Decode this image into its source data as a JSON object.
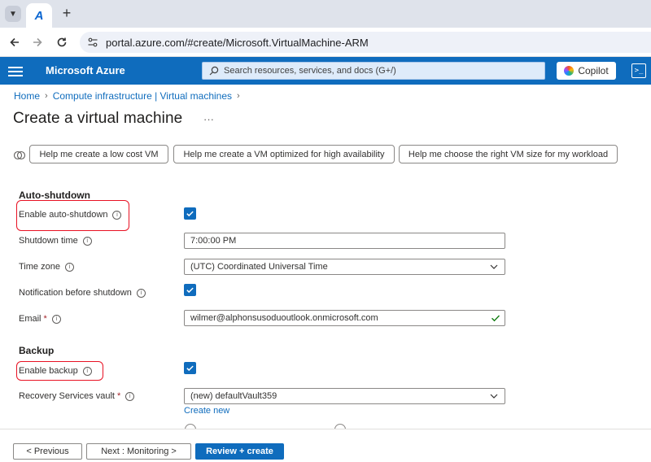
{
  "browser": {
    "new_tab_symbol": "+",
    "url": "portal.azure.com/#create/Microsoft.VirtualMachine-ARM"
  },
  "header": {
    "brand": "Microsoft Azure",
    "search_placeholder": "Search resources, services, and docs (G+/)",
    "copilot_label": "Copilot"
  },
  "breadcrumb": [
    "Home",
    "Compute infrastructure | Virtual machines"
  ],
  "page": {
    "title": "Create a virtual machine",
    "more": "···"
  },
  "suggestions": [
    "Help me create a low cost VM",
    "Help me create a VM optimized for high availability",
    "Help me choose the right VM size for my workload"
  ],
  "auto_shutdown": {
    "section_title": "Auto-shutdown",
    "enable_label": "Enable auto-shutdown",
    "enable_checked": true,
    "shutdown_time_label": "Shutdown time",
    "shutdown_time_value": "7:00:00 PM",
    "time_zone_label": "Time zone",
    "time_zone_value": "(UTC) Coordinated Universal Time",
    "notification_label": "Notification before shutdown",
    "notification_checked": true,
    "email_label": "Email",
    "email_required": "*",
    "email_value": "wilmer@alphonsusoduoutlook.onmicrosoft.com"
  },
  "backup": {
    "section_title": "Backup",
    "enable_label": "Enable backup",
    "enable_checked": true,
    "vault_label": "Recovery Services vault",
    "vault_required": "*",
    "vault_value": "(new) defaultVault359",
    "create_new_link": "Create new"
  },
  "footer": {
    "previous": "< Previous",
    "next": "Next : Monitoring >",
    "review": "Review + create"
  },
  "colors": {
    "azure_blue": "#0f6cbd",
    "highlight_red": "#e81123"
  }
}
